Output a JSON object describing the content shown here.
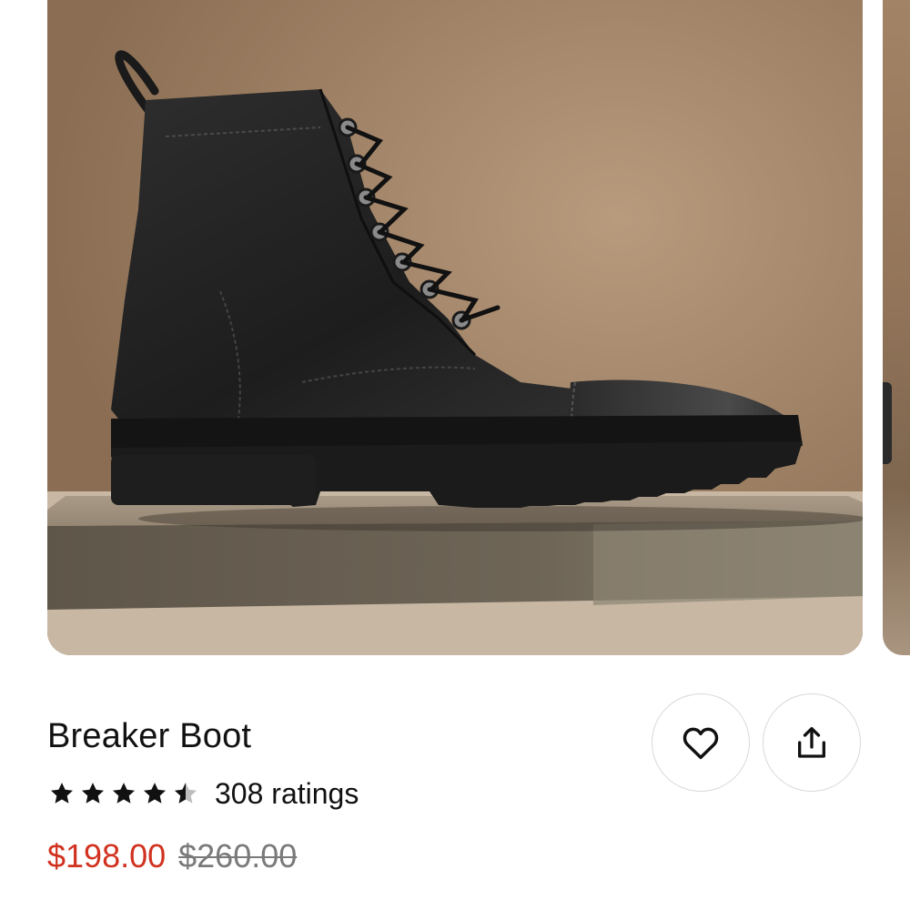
{
  "product": {
    "title": "Breaker Boot",
    "rating": 4.5,
    "rating_count_label": "308 ratings",
    "sale_price": "$198.00",
    "original_price": "$260.00"
  },
  "image": {
    "subject": "black leather lace-up cap-toe boot on a stone block"
  },
  "actions": {
    "favorite_icon": "heart-outline-icon",
    "share_icon": "share-upload-icon"
  },
  "colors": {
    "sale_price": "#d1321f",
    "original_price": "#7a7a7a",
    "text": "#111111",
    "button_border": "#d9d9d9"
  }
}
